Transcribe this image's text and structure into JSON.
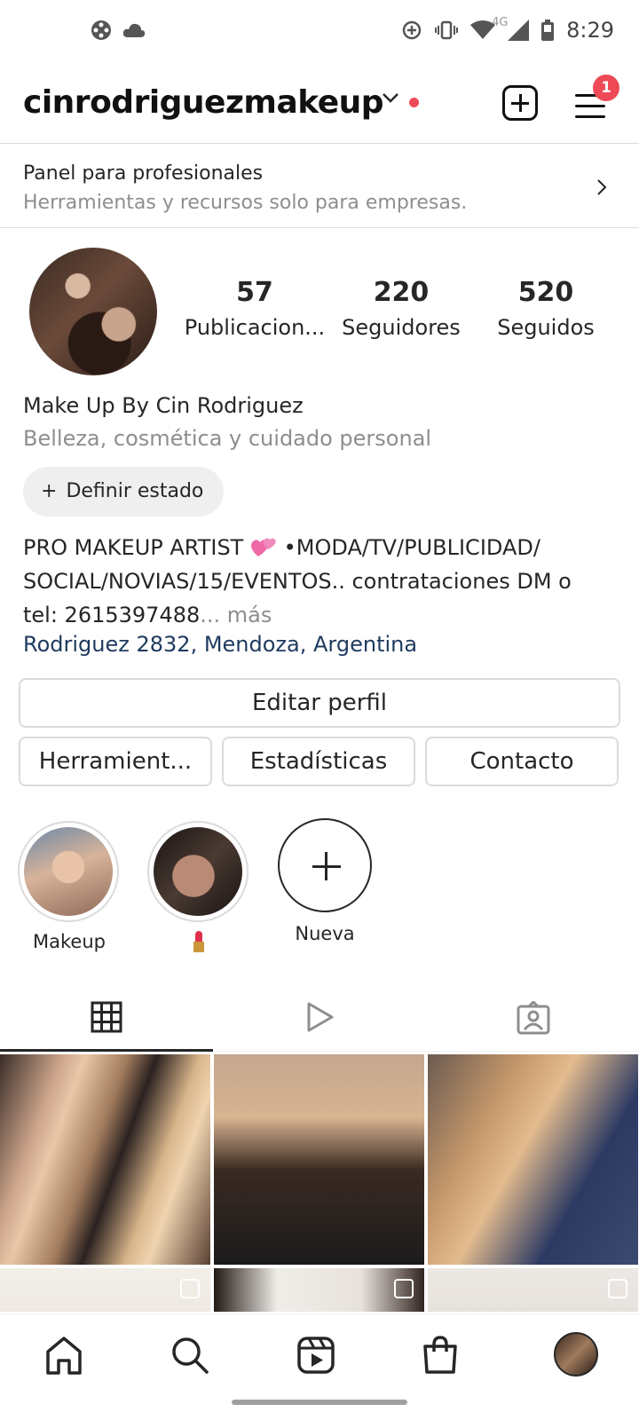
{
  "status_bar": {
    "time": "8:29",
    "network": "4G",
    "icons": [
      "game-icon",
      "cloud-icon",
      "data-saver-icon",
      "vibrate-icon",
      "wifi-icon",
      "signal-icon",
      "battery-icon"
    ]
  },
  "header": {
    "username": "cinrodriguezmakeup",
    "notification_count": "1",
    "accent": "#ed4956"
  },
  "pro_panel": {
    "title": "Panel para profesionales",
    "subtitle": "Herramientas y recursos solo para empresas."
  },
  "profile": {
    "stats": [
      {
        "value": "57",
        "label": "Publicacion..."
      },
      {
        "value": "220",
        "label": "Seguidores"
      },
      {
        "value": "520",
        "label": "Seguidos"
      }
    ],
    "name": "Make Up By Cin Rodriguez",
    "category": "Belleza, cosmética y cuidado personal",
    "status_button": "Definir estado",
    "bio_line1": "PRO MAKEUP ARTIST",
    "bio_line1b": "•MODA/TV/PUBLICIDAD/",
    "bio_line2": "SOCIAL/NOVIAS/15/EVENTOS.. contrataciones DM o",
    "bio_line3": "tel: 2615397488",
    "bio_more": "... más",
    "location": "Rodriguez 2832, Mendoza, Argentina",
    "link_color": "#1e3a5f"
  },
  "buttons": {
    "edit_profile": "Editar perfil",
    "tools": "Herramient...",
    "insights": "Estadísticas",
    "contact": "Contacto"
  },
  "highlights": [
    {
      "label": "Makeup"
    },
    {
      "label": "lipstick-emoji"
    },
    {
      "label": "Nueva"
    }
  ],
  "tabs": [
    "grid-icon",
    "reels-icon",
    "tagged-icon"
  ],
  "bottom_nav": [
    "home-icon",
    "search-icon",
    "reels-icon",
    "shop-icon",
    "profile-avatar"
  ]
}
